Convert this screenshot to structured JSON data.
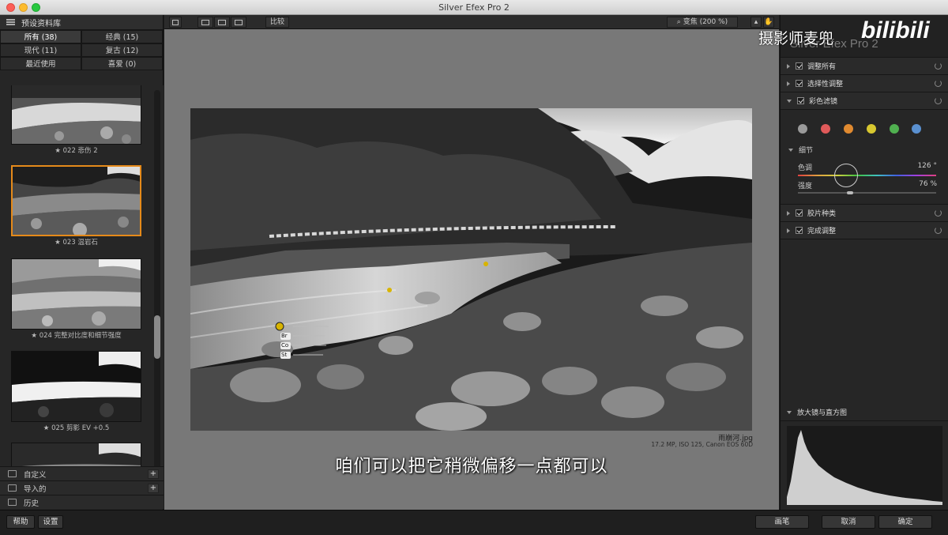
{
  "window": {
    "title": "Silver Efex Pro 2"
  },
  "library": {
    "header": "预设资料库",
    "filters": [
      {
        "label": "所有 (38)"
      },
      {
        "label": "经典 (15)"
      },
      {
        "label": "现代 (11)"
      },
      {
        "label": "复古 (12)"
      },
      {
        "label": "最近使用"
      },
      {
        "label": "喜爱 (0)"
      }
    ],
    "presets": [
      {
        "label": "★ 022 悲伤 2"
      },
      {
        "label": "★ 023 温岩石"
      },
      {
        "label": "★ 024 完整对比度和细节强度"
      },
      {
        "label": "★ 025 剪影 EV +0.5"
      }
    ],
    "bottom": [
      {
        "label": "自定义"
      },
      {
        "label": "导入的"
      },
      {
        "label": "历史"
      }
    ]
  },
  "toolbar": {
    "compare_label": "比较",
    "zoom_label": "变焦 (200 %)"
  },
  "image": {
    "filename": "雨崩河.jpg",
    "info": "17.2 MP, ISO 125, Canon EOS 60D",
    "cp_labels": [
      "Br",
      "Co",
      "St"
    ]
  },
  "subtitle": "咱们可以把它稍微偏移一点都可以",
  "right": {
    "brand": "Silver Efex Pro 2",
    "sections": [
      {
        "label": "调整所有"
      },
      {
        "label": "选择性调整"
      },
      {
        "label": "彩色滤镜"
      }
    ],
    "color_dots": [
      "#9a9a9a",
      "#e05a5a",
      "#e08a30",
      "#d8c830",
      "#50b050",
      "#5a90d0"
    ],
    "detail": {
      "header": "细节",
      "hue_label": "色调",
      "hue_value": "126 °",
      "strength_label": "强度",
      "strength_value": "76 %"
    },
    "sections2": [
      {
        "label": "胶片种类"
      },
      {
        "label": "完成调整"
      }
    ],
    "histogram_label": "放大镜与直方图"
  },
  "bottom": {
    "help": "帮助",
    "settings": "设置",
    "brush": "画笔",
    "cancel": "取消",
    "ok": "确定"
  },
  "watermark": {
    "text": "摄影师麦兜",
    "logo": "bilibili"
  }
}
